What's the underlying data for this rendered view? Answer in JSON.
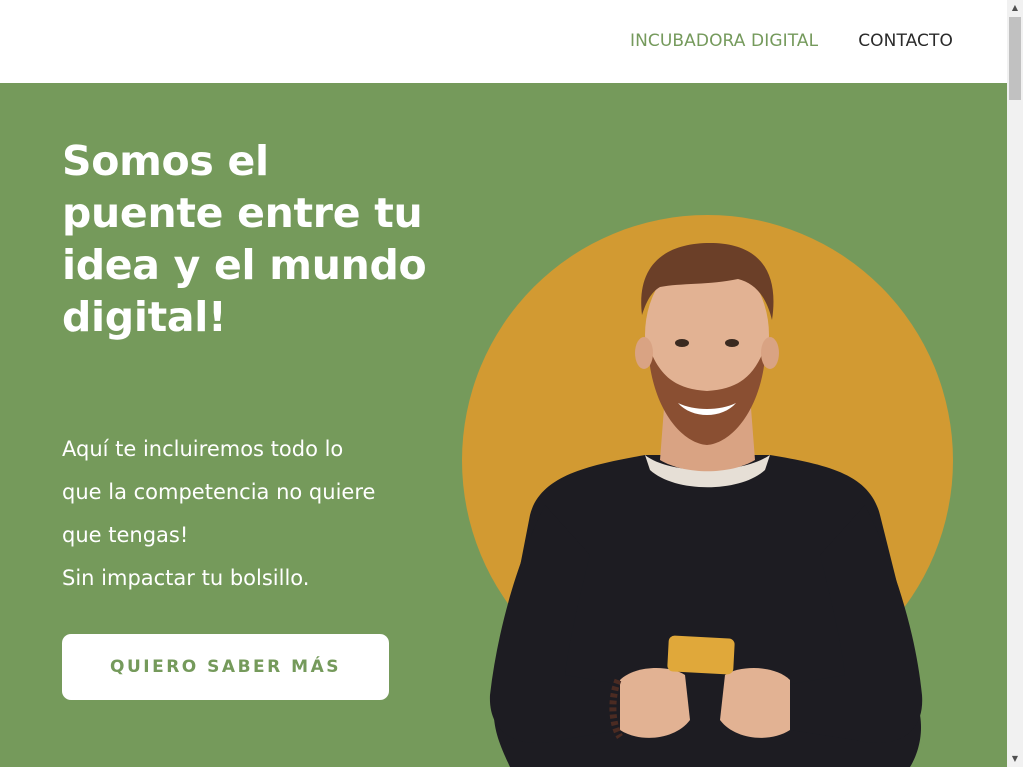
{
  "nav": {
    "items": [
      {
        "label": "INCUBADORA DIGITAL",
        "active": true
      },
      {
        "label": "CONTACTO",
        "active": false
      }
    ]
  },
  "hero": {
    "headline": "Somos el puente entre tu idea y el mundo digital!",
    "subtext_lines": [
      "Aquí te incluiremos todo lo",
      "que la competencia no quiere",
      "que tengas!",
      "Sin impactar tu bolsillo."
    ],
    "cta_label": "QUIERO SABER MÁS",
    "illustration": "smiling-man-holding-phone"
  },
  "colors": {
    "hero_background": "#759a5b",
    "accent_circle": "#d29a32",
    "nav_active": "#759a5c",
    "cta_text": "#759a5b"
  },
  "icons": {
    "scroll_up": "scroll-up-arrow-icon",
    "scroll_down": "scroll-down-arrow-icon"
  }
}
